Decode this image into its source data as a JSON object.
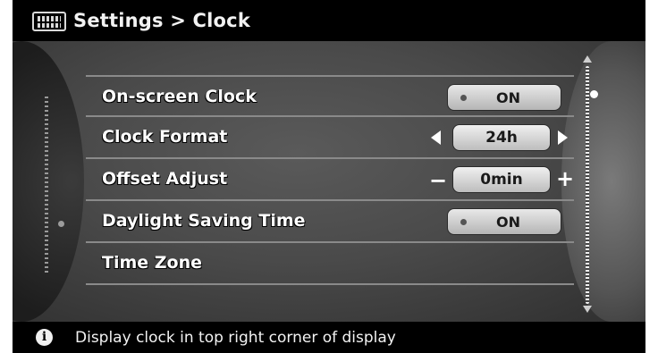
{
  "header": {
    "title": "Settings > Clock",
    "icon": "menu-grid-icon"
  },
  "rows": [
    {
      "label": "On-screen Clock",
      "control": "toggle",
      "value": "ON"
    },
    {
      "label": "Clock Format",
      "control": "selector",
      "value": "24h"
    },
    {
      "label": "Offset Adjust",
      "control": "stepper",
      "value": "0min"
    },
    {
      "label": "Daylight Saving Time",
      "control": "toggle",
      "value": "ON"
    },
    {
      "label": "Time Zone",
      "control": "none"
    }
  ],
  "footer": {
    "icon": "info-icon",
    "icon_glyph": "i",
    "hint": "Display clock in top right corner of display"
  },
  "colors": {
    "background": "#000000",
    "panel": "#4a4a4a",
    "text": "#ffffff",
    "button": "#d0d0d0"
  }
}
